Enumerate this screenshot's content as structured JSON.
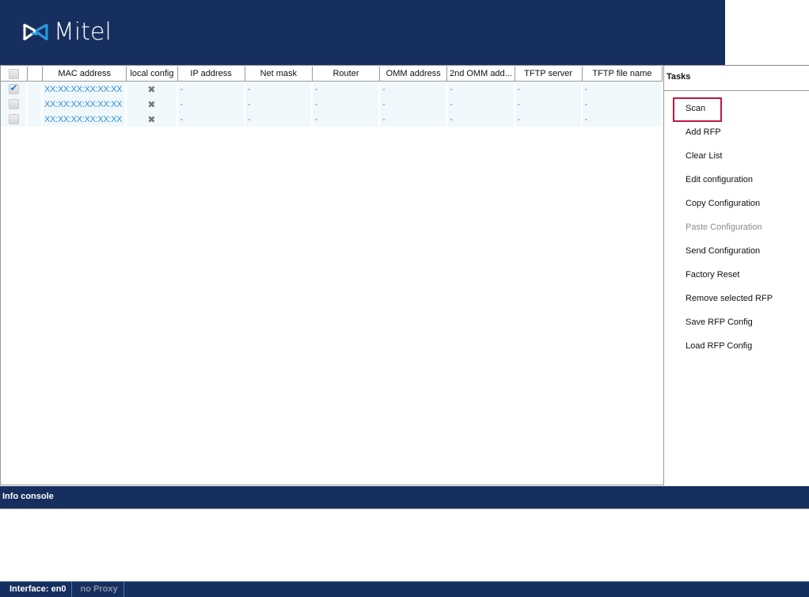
{
  "header": {
    "brand": "Mitel",
    "logo_icon": "mitel-bowtie-logo"
  },
  "table": {
    "columns": [
      "",
      "",
      "MAC address",
      "local config",
      "IP address",
      "Net mask",
      "Router",
      "OMM address",
      "2nd OMM add...",
      "TFTP server",
      "TFTP file name"
    ],
    "rows": [
      {
        "checked": true,
        "mac": "XX:XX:XX:XX:XX:XX",
        "local_config_icon": "x-icon",
        "ip": "-",
        "netmask": "-",
        "router": "-",
        "omm": "-",
        "omm2": "-",
        "tftp_server": "-",
        "tftp_file": "-"
      },
      {
        "checked": false,
        "mac": "XX:XX:XX:XX:XX:XX",
        "local_config_icon": "x-icon",
        "ip": "-",
        "netmask": "-",
        "router": "-",
        "omm": "-",
        "omm2": "-",
        "tftp_server": "-",
        "tftp_file": "-"
      },
      {
        "checked": false,
        "mac": "XX:XX:XX:XX:XX:XX",
        "local_config_icon": "x-icon",
        "ip": "-",
        "netmask": "-",
        "router": "-",
        "omm": "-",
        "omm2": "-",
        "tftp_server": "-",
        "tftp_file": "-"
      }
    ]
  },
  "tasks": {
    "title": "Tasks",
    "items": [
      {
        "label": "Scan",
        "enabled": true,
        "highlighted": true
      },
      {
        "label": "Add RFP",
        "enabled": true
      },
      {
        "label": "Clear List",
        "enabled": true
      },
      {
        "label": "Edit configuration",
        "enabled": true
      },
      {
        "label": "Copy Configuration",
        "enabled": true
      },
      {
        "label": "Paste Configuration",
        "enabled": false
      },
      {
        "label": "Send Configuration",
        "enabled": true
      },
      {
        "label": "Factory Reset",
        "enabled": true
      },
      {
        "label": "Remove selected RFP",
        "enabled": true
      },
      {
        "label": "Save RFP Config",
        "enabled": true
      },
      {
        "label": "Load RFP Config",
        "enabled": true
      }
    ]
  },
  "info_console": {
    "title": "Info console",
    "content": ""
  },
  "status_bar": {
    "interface": "Interface: en0",
    "proxy": "no Proxy"
  },
  "colors": {
    "brand_navy": "#172f5e",
    "link_blue": "#2a8fd8",
    "highlight_red": "#c0163f",
    "row_bg": "#f1f8fc"
  }
}
